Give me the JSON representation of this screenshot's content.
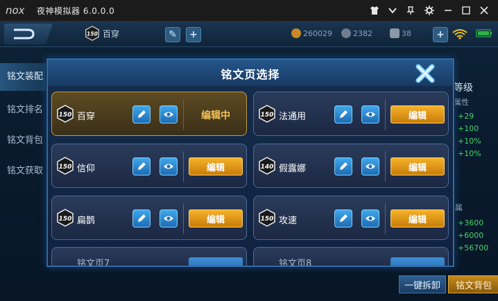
{
  "titlebar": {
    "app_title": "夜神模拟器 6.0.0.0",
    "logo_text": "nox",
    "buttons": [
      "shirt-icon",
      "chevron-down-icon",
      "pin-icon",
      "gear-icon",
      "minimize-icon",
      "maximize-icon",
      "close-icon"
    ]
  },
  "topbar": {
    "page_level": "150",
    "page_name": "百穿",
    "resources": [
      {
        "value": "260029",
        "color": "#e0a030"
      },
      {
        "value": "2382",
        "color": "#9aa7b4"
      },
      {
        "value": "38",
        "color": "#b8c6d4"
      }
    ]
  },
  "sidebar": {
    "items": [
      {
        "label": "铭文装配"
      },
      {
        "label": "铭文排名"
      },
      {
        "label": "铭文背包"
      },
      {
        "label": "铭文获取"
      }
    ]
  },
  "right_panel": {
    "title": "等级",
    "subtitle": "属性",
    "stats": [
      "+29",
      "+100",
      "+10%",
      "+10%"
    ],
    "subtitle2": "属",
    "stats2": [
      "+3600",
      "+6000",
      "+56700"
    ]
  },
  "bottom_buttons": {
    "disassemble": "一键拆卸",
    "bag": "铭文背包"
  },
  "modal": {
    "title": "铭文页选择",
    "editing_label": "编辑中",
    "edit_label": "编辑",
    "cards": [
      {
        "level": "150",
        "name": "百穿",
        "active": true
      },
      {
        "level": "150",
        "name": "法通用",
        "active": false
      },
      {
        "level": "150",
        "name": "信仰",
        "active": false
      },
      {
        "level": "140",
        "name": "假露娜",
        "active": false
      },
      {
        "level": "150",
        "name": "扁鹊",
        "active": false
      },
      {
        "level": "150",
        "name": "攻速",
        "active": false
      }
    ],
    "partial_cards": [
      {
        "name": "铭文页7"
      },
      {
        "name": "铭文页8"
      }
    ]
  },
  "colors": {
    "accent_gold": "#f4b22a",
    "accent_blue": "#41a7ea",
    "modal_border": "#2e6ea8",
    "stat_green": "#49d36a"
  }
}
